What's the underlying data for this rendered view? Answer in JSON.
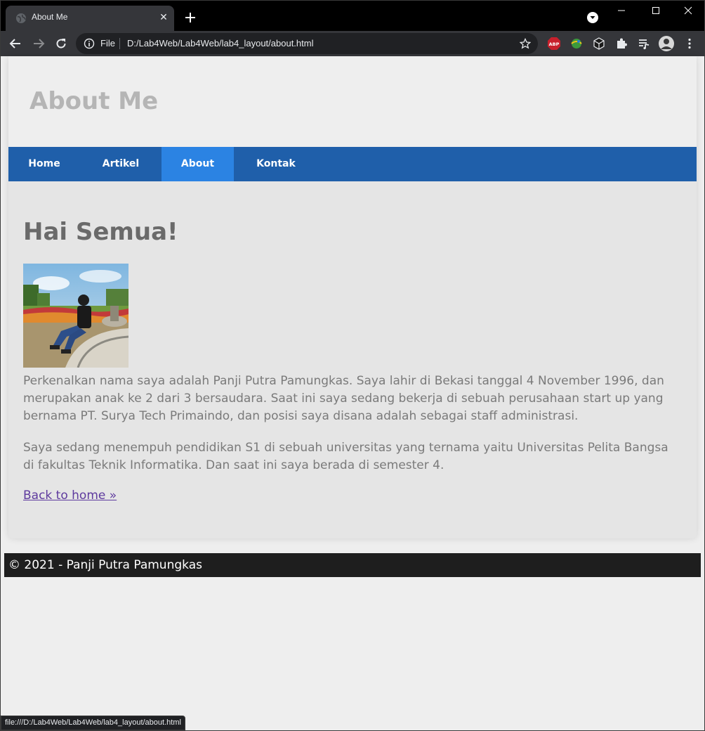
{
  "browser": {
    "tab_title": "About Me",
    "url_scheme": "File",
    "url": "D:/Lab4Web/Lab4Web/lab4_layout/about.html",
    "status_url": "file:///D:/Lab4Web/Lab4Web/lab4_layout/about.html",
    "extensions": [
      "adblock-plus-icon",
      "extension-globe-icon",
      "extension-cube-icon",
      "puzzle-icon",
      "media-queue-icon",
      "profile-avatar"
    ],
    "abp_label": "ABP"
  },
  "site": {
    "title": "About Me",
    "nav": [
      {
        "label": "Home",
        "active": false
      },
      {
        "label": "Artikel",
        "active": false
      },
      {
        "label": "About",
        "active": true
      },
      {
        "label": "Kontak",
        "active": false
      }
    ]
  },
  "content": {
    "heading": "Hai Semua!",
    "paragraph1": "Perkenalkan nama saya adalah Panji Putra Pamungkas. Saya lahir di Bekasi tanggal 4 November 1996, dan merupakan anak ke 2 dari 3 bersaudara. Saat ini saya sedang bekerja di sebuah perusahaan start up yang bernama PT. Surya Tech Primaindo, dan posisi saya disana adalah sebagai staff administrasi.",
    "paragraph2": "Saya sedang menempuh pendidikan S1 di sebuah universitas yang ternama yaitu Universitas Pelita Bangsa di fakultas Teknik Informatika. Dan saat ini saya berada di semester 4.",
    "back_link": "Back to home »"
  },
  "footer": {
    "text": "© 2021 - Panji Putra Pamungkas"
  },
  "colors": {
    "nav_bg": "#1f5faa",
    "nav_active": "#2b83e3",
    "footer_bg": "#1e1e1e",
    "link_visited": "#5e3a9e"
  }
}
